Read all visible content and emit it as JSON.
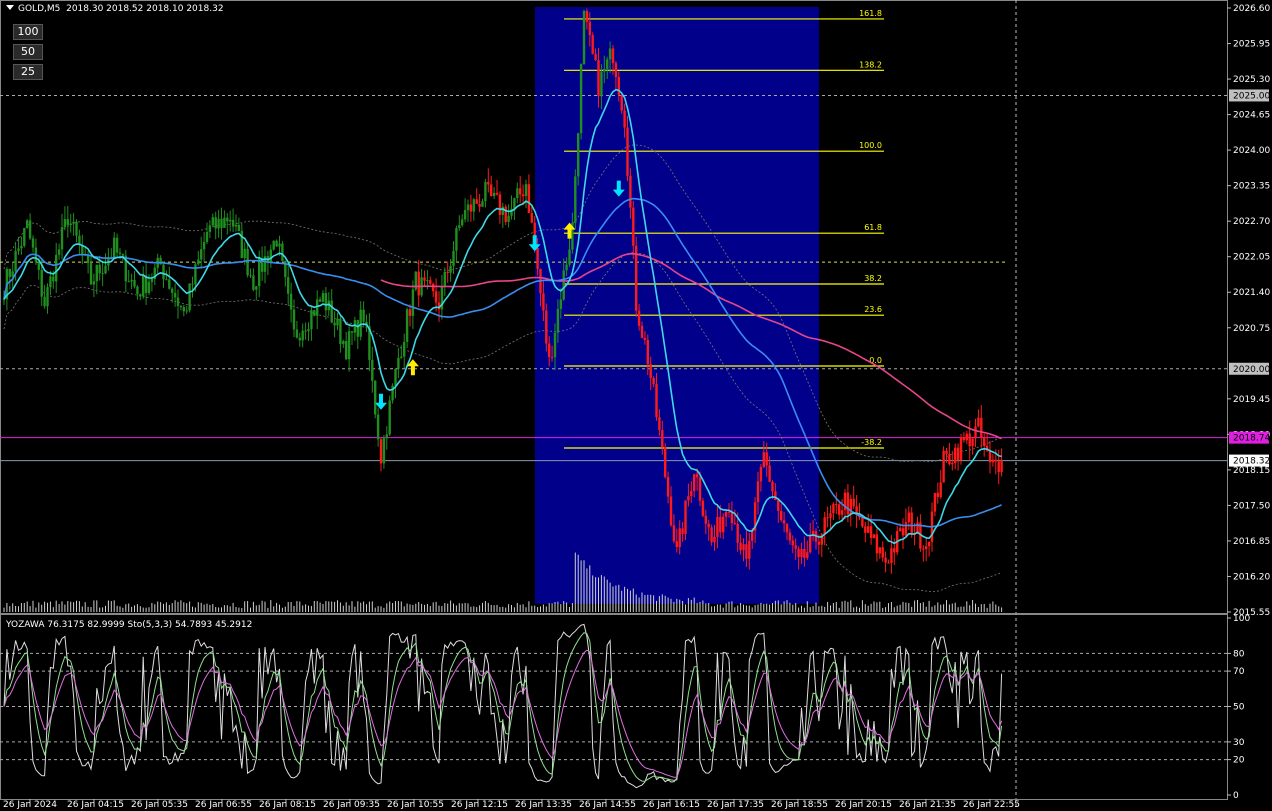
{
  "chart_header": {
    "symbol_timeframe": "GOLD,M5",
    "ohlc": "2018.30 2018.52 2018.10 2018.32"
  },
  "indicator_header": {
    "text": "YOZAWA 76.3175 82.9999  Sto(5,3,3) 54.7893 45.2912"
  },
  "level_buttons": [
    {
      "label": "100",
      "color": "#8a8a8a"
    },
    {
      "label": "50",
      "color": "#8a8a8a"
    },
    {
      "label": "25",
      "color": "#e03030"
    }
  ],
  "price_axis": {
    "ticks": [
      "2026.60",
      "2025.95",
      "2025.30",
      "2024.65",
      "2024.00",
      "2023.35",
      "2022.70",
      "2022.05",
      "2021.40",
      "2020.75",
      "2019.45",
      "2018.80",
      "2018.15",
      "2017.50",
      "2016.85",
      "2016.20",
      "2015.55"
    ],
    "ymin": 2015.55,
    "ymax": 2026.6,
    "tags": [
      {
        "label": "2025.00",
        "price": 2025.0,
        "bg": "#c0c0c0",
        "fg": "#000"
      },
      {
        "label": "2020.00",
        "price": 2020.0,
        "bg": "#c0c0c0",
        "fg": "#000"
      },
      {
        "label": "2018.74",
        "price": 2018.74,
        "bg": "#e020e0",
        "fg": "#000"
      },
      {
        "label": "2018.32",
        "price": 2018.32,
        "bg": "#ffffff",
        "fg": "#000"
      }
    ]
  },
  "indicator_axis": {
    "ticks": [
      "100",
      "80",
      "70",
      "50",
      "30",
      "20",
      "0"
    ],
    "levels": [
      80,
      70,
      50,
      30,
      20
    ]
  },
  "time_axis": {
    "labels": [
      "26 Jan 2024",
      "26 Jan 04:15",
      "26 Jan 05:35",
      "26 Jan 06:55",
      "26 Jan 08:15",
      "26 Jan 09:35",
      "26 Jan 10:55",
      "26 Jan 12:15",
      "26 Jan 13:35",
      "26 Jan 14:55",
      "26 Jan 16:15",
      "26 Jan 17:35",
      "26 Jan 18:55",
      "26 Jan 20:15",
      "26 Jan 21:35",
      "26 Jan 22:55"
    ]
  },
  "fibonacci": {
    "levels": [
      {
        "label": "161.8",
        "price": 2026.4
      },
      {
        "label": "138.2",
        "price": 2025.46
      },
      {
        "label": "100.0",
        "price": 2023.98
      },
      {
        "label": "61.8",
        "price": 2022.48
      },
      {
        "label": "38.2",
        "price": 2021.55
      },
      {
        "label": "23.6",
        "price": 2020.98
      },
      {
        "label": "0.0",
        "price": 2020.05
      },
      {
        "label": "-38.2",
        "price": 2018.55
      }
    ],
    "color": "#ffff00",
    "box_color": "#00008b"
  },
  "horizontal_lines": [
    {
      "price": 2025.0,
      "style": "dashed",
      "color": "#aaaaaa"
    },
    {
      "price": 2020.0,
      "style": "dashed",
      "color": "#aaaaaa"
    },
    {
      "price": 2018.74,
      "style": "solid",
      "color": "#e020e0"
    },
    {
      "price": 2018.32,
      "style": "solid",
      "color": "#8899aa"
    },
    {
      "price": 2021.95,
      "style": "dashed",
      "color": "#dddd55"
    }
  ],
  "signals": [
    {
      "type": "down",
      "color": "#00e5ff",
      "bar": 130,
      "price": 2019.25
    },
    {
      "type": "up",
      "color": "#ffee00",
      "bar": 141,
      "price": 2020.1
    },
    {
      "type": "down",
      "color": "#00e5ff",
      "bar": 183,
      "price": 2022.15
    },
    {
      "type": "up",
      "color": "#ffee00",
      "bar": 195,
      "price": 2022.6
    },
    {
      "type": "down",
      "color": "#00e5ff",
      "bar": 212,
      "price": 2023.15
    }
  ],
  "colors": {
    "bull": "#1f8f1f",
    "bear": "#ff1a1a",
    "ma_fast": "#3fd8e8",
    "ma_mid": "#3a8df0",
    "ma_slow": "#e8448c",
    "stoch_main": "#dddddd",
    "stoch_a": "#e070e0",
    "stoch_b": "#90e090"
  },
  "chart_data": {
    "type": "candlestick",
    "symbol": "GOLD",
    "timeframe": "M5",
    "ylim": [
      2015.55,
      2026.6
    ],
    "bars": 280,
    "path_pivots": [
      [
        0,
        2021.5
      ],
      [
        8,
        2022.6
      ],
      [
        14,
        2021.2
      ],
      [
        22,
        2022.8
      ],
      [
        30,
        2021.6
      ],
      [
        38,
        2022.2
      ],
      [
        46,
        2021.4
      ],
      [
        54,
        2021.9
      ],
      [
        62,
        2021.0
      ],
      [
        70,
        2022.5
      ],
      [
        78,
        2022.8
      ],
      [
        86,
        2021.6
      ],
      [
        94,
        2022.4
      ],
      [
        100,
        2020.6
      ],
      [
        110,
        2021.3
      ],
      [
        118,
        2020.4
      ],
      [
        124,
        2021.0
      ],
      [
        130,
        2018.4
      ],
      [
        136,
        2020.2
      ],
      [
        142,
        2021.6
      ],
      [
        150,
        2021.2
      ],
      [
        158,
        2022.8
      ],
      [
        166,
        2023.2
      ],
      [
        174,
        2022.8
      ],
      [
        180,
        2023.4
      ],
      [
        184,
        2021.8
      ],
      [
        188,
        2020.1
      ],
      [
        192,
        2021.4
      ],
      [
        196,
        2022.6
      ],
      [
        200,
        2026.4
      ],
      [
        205,
        2025.2
      ],
      [
        210,
        2025.8
      ],
      [
        214,
        2024.6
      ],
      [
        218,
        2021.2
      ],
      [
        222,
        2020.2
      ],
      [
        226,
        2018.8
      ],
      [
        232,
        2016.6
      ],
      [
        238,
        2018.2
      ],
      [
        244,
        2016.8
      ],
      [
        250,
        2017.6
      ],
      [
        256,
        2016.4
      ],
      [
        262,
        2018.4
      ],
      [
        268,
        2017.2
      ],
      [
        274,
        2016.4
      ],
      [
        280,
        2016.9
      ]
    ],
    "closes_tail": [
      [
        280,
        2016.9
      ],
      [
        290,
        2017.6
      ],
      [
        296,
        2017.1
      ],
      [
        304,
        2016.5
      ],
      [
        312,
        2017.2
      ],
      [
        318,
        2016.8
      ],
      [
        324,
        2018.3
      ],
      [
        330,
        2018.6
      ],
      [
        336,
        2018.9
      ],
      [
        340,
        2018.2
      ],
      [
        344,
        2018.32
      ]
    ],
    "last_close": 2018.32
  }
}
